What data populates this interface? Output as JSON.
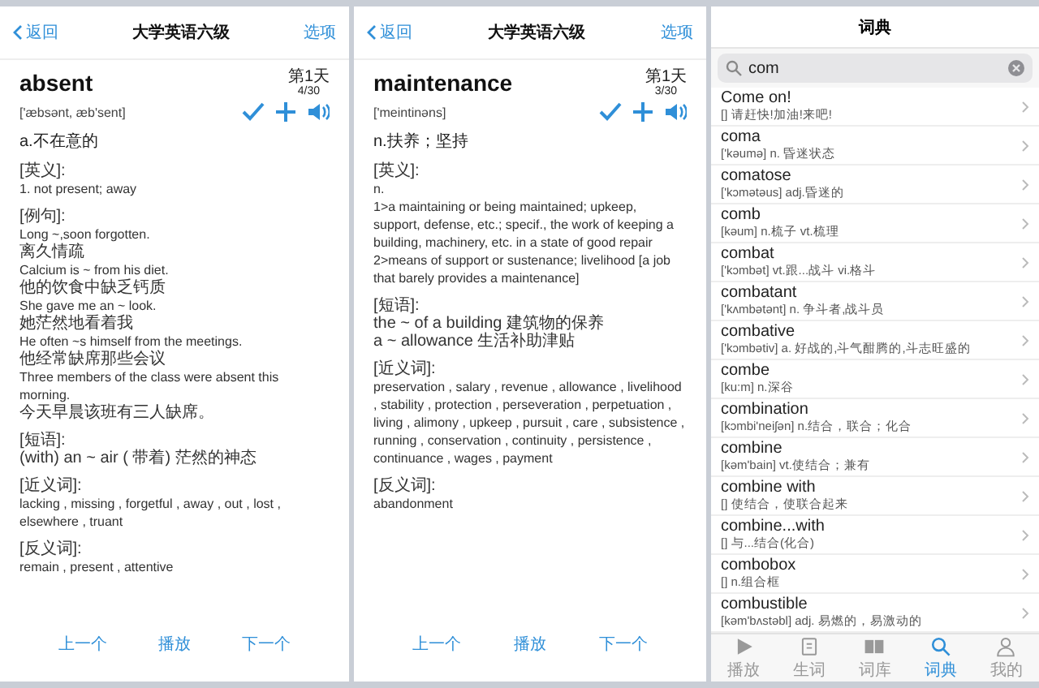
{
  "word_panels": [
    {
      "nav": {
        "back": "返回",
        "title": "大学英语六级",
        "options": "选项"
      },
      "word": "absent",
      "day": "第1天",
      "progress": "4/30",
      "phonetic": "['æbsənt, æb'sent]",
      "meaning": "a.不在意的",
      "sections": [
        {
          "heading": "[英义]:",
          "lines": [
            "1. not present; away"
          ]
        },
        {
          "heading": "[例句]:",
          "lines": [
            "Long ~,soon forgotten.",
            "离久情疏",
            "Calcium is ~ from his diet.",
            "他的饮食中缺乏钙质",
            "She gave me an ~ look.",
            "她茫然地看着我",
            "He often ~s himself from the meetings.",
            "他经常缺席那些会议",
            "Three members of the class were absent this morning.",
            "今天早晨该班有三人缺席。"
          ]
        },
        {
          "heading": "[短语]:",
          "lines": [
            "(with) an ~ air ( 带着) 茫然的神态"
          ]
        },
        {
          "heading": "[近义词]:",
          "lines": [
            "lacking , missing , forgetful , away , out , lost , elsewhere , truant"
          ]
        },
        {
          "heading": "[反义词]:",
          "lines": [
            "remain , present , attentive"
          ]
        }
      ],
      "buttons": [
        "上一个",
        "播放",
        "下一个"
      ]
    },
    {
      "nav": {
        "back": "返回",
        "title": "大学英语六级",
        "options": "选项"
      },
      "word": "maintenance",
      "day": "第1天",
      "progress": "3/30",
      "phonetic": "['meintinəns]",
      "meaning": "n.扶养；坚持",
      "sections": [
        {
          "heading": "[英义]:",
          "lines": [
            "n.",
            "1>a maintaining or being maintained; upkeep, support, defense, etc.; specif., the work of keeping a building, machinery, etc. in a state of good repair",
            "2>means of support or sustenance; livelihood [a job that barely provides a maintenance]"
          ]
        },
        {
          "heading": "[短语]:",
          "lines": [
            "the ~ of a building 建筑物的保养",
            "a ~ allowance 生活补助津贴"
          ]
        },
        {
          "heading": "[近义词]:",
          "lines": [
            "preservation , salary , revenue , allowance , livelihood , stability , protection , perseveration , perpetuation , living , alimony , upkeep , pursuit , care , subsistence , running , conservation , continuity , persistence , continuance , wages , payment"
          ]
        },
        {
          "heading": "[反义词]:",
          "lines": [
            "abandonment"
          ]
        }
      ],
      "buttons": [
        "上一个",
        "播放",
        "下一个"
      ]
    }
  ],
  "dictionary": {
    "title": "词典",
    "search": {
      "value": "com"
    },
    "entries": [
      {
        "word": "Come on!",
        "detail": "[] 请赶快!加油!来吧!"
      },
      {
        "word": "coma",
        "detail": "['kəumə] n. 昏迷状态"
      },
      {
        "word": "comatose",
        "detail": "['kɔmətəus] adj.昏迷的"
      },
      {
        "word": "comb",
        "detail": "[kəum] n.梳子 vt.梳理"
      },
      {
        "word": "combat",
        "detail": "['kɔmbət] vt.跟...战斗 vi.格斗"
      },
      {
        "word": "combatant",
        "detail": "['kʌmbətənt] n. 争斗者,战斗员"
      },
      {
        "word": "combative",
        "detail": "['kɔmbətiv] a. 好战的,斗气酣腾的,斗志旺盛的"
      },
      {
        "word": "combe",
        "detail": "[ku:m] n.深谷"
      },
      {
        "word": "combination",
        "detail": "[kɔmbi'neiʃən] n.结合，联合；化合"
      },
      {
        "word": "combine",
        "detail": "[kəm'bain] vt.使结合；兼有"
      },
      {
        "word": "combine with",
        "detail": "[] 使结合，使联合起来"
      },
      {
        "word": "combine...with",
        "detail": "[] 与...结合(化合)"
      },
      {
        "word": "combobox",
        "detail": "[] n.组合框"
      },
      {
        "word": "combustible",
        "detail": "[kəm'bʌstəbl] adj. 易燃的，易激动的"
      }
    ],
    "tabs": [
      {
        "label": "播放",
        "selected": false
      },
      {
        "label": "生词",
        "selected": false
      },
      {
        "label": "词库",
        "selected": false
      },
      {
        "label": "词典",
        "selected": true
      },
      {
        "label": "我的",
        "selected": false
      }
    ]
  }
}
